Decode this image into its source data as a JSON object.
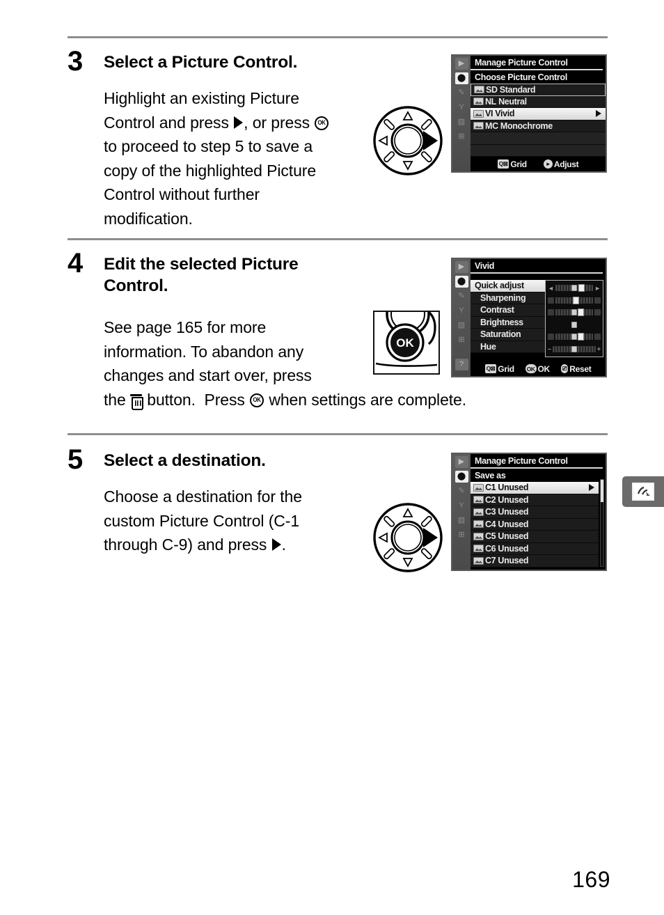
{
  "page": {
    "number": "169",
    "side_tab_icon": "retouch-menu-icon"
  },
  "steps": [
    {
      "number": "3",
      "heading": "Select a Picture Control.",
      "body_lines": [
        "Highlight an existing Picture",
        "Control and press ▶, or press ⒪",
        "to proceed to step 5 to save a",
        "copy of the highlighted Picture",
        "Control without further",
        "modification."
      ],
      "illustration": "multi-selector-right"
    },
    {
      "number": "4",
      "heading_lines": [
        "Edit the selected Picture",
        "Control."
      ],
      "body_lines": [
        "See page 165 for more",
        "information.   To abandon any",
        "changes and start over, press",
        "the ♻ button.  Press ⒪ when settings are complete."
      ],
      "illustration": "ok-button"
    },
    {
      "number": "5",
      "heading": "Select a destination.",
      "body_lines": [
        "Choose a destination for the",
        "custom Picture Control (C-1",
        "through C-9) and press ▶."
      ],
      "illustration": "multi-selector-right"
    }
  ],
  "lcd_screens": [
    {
      "id": "manage-picture-control-choose",
      "title": "Manage Picture Control",
      "subtitle": "Choose Picture Control",
      "rows": [
        {
          "badge": "SD",
          "label": "Standard",
          "state": "boxed",
          "arrow": false
        },
        {
          "badge": "NL",
          "label": "Neutral",
          "state": "normal",
          "arrow": false
        },
        {
          "badge": "VI",
          "label": "Vivid",
          "state": "selected",
          "arrow": true
        },
        {
          "badge": "MC",
          "label": "Monochrome",
          "state": "normal",
          "arrow": false
        }
      ],
      "bottom_hints": [
        {
          "key": "Q",
          "label": "Grid"
        },
        {
          "key": "▶",
          "label": "Adjust"
        }
      ],
      "sidebar_icons": [
        "playback-icon",
        "shooting-menu-icon",
        "custom-settings-icon",
        "setup-menu-icon",
        "retouch-menu-icon",
        "recent-settings-icon"
      ],
      "sidebar_active_index": 1
    },
    {
      "id": "vivid-edit",
      "title": "Vivid",
      "subtitle": "",
      "rows": [
        {
          "label": "Quick adjust",
          "state": "selected",
          "slider": {
            "value": 0,
            "knob": 62
          }
        },
        {
          "label": "Sharpening",
          "state": "normal",
          "slider": {
            "value": 0,
            "knob": 50
          }
        },
        {
          "label": "Contrast",
          "state": "normal",
          "slider": {
            "value": 0,
            "knob": 62
          }
        },
        {
          "label": "Brightness",
          "state": "normal",
          "slider": {
            "value": 0,
            "knob": 50
          }
        },
        {
          "label": "Saturation",
          "state": "normal",
          "slider": {
            "value": 0,
            "knob": 62
          }
        },
        {
          "label": "Hue",
          "state": "normal",
          "slider": {
            "value": 0,
            "knob": 50
          }
        }
      ],
      "bottom_hints": [
        {
          "key": "Q",
          "label": "Grid"
        },
        {
          "key": "OK",
          "label": "OK"
        },
        {
          "key": "♻",
          "label": "Reset"
        }
      ],
      "sidebar_icons": [
        "playback-icon",
        "shooting-menu-icon",
        "custom-settings-icon",
        "setup-menu-icon",
        "retouch-menu-icon",
        "recent-settings-icon",
        "help-icon"
      ],
      "sidebar_active_index": 1
    },
    {
      "id": "manage-picture-control-save-as",
      "title": "Manage Picture Control",
      "subtitle": "Save as",
      "rows": [
        {
          "badge": "C1",
          "label": "Unused",
          "state": "selected",
          "arrow": true
        },
        {
          "badge": "C2",
          "label": "Unused",
          "state": "normal",
          "arrow": false
        },
        {
          "badge": "C3",
          "label": "Unused",
          "state": "normal",
          "arrow": false
        },
        {
          "badge": "C4",
          "label": "Unused",
          "state": "normal",
          "arrow": false
        },
        {
          "badge": "C5",
          "label": "Unused",
          "state": "normal",
          "arrow": false
        },
        {
          "badge": "C6",
          "label": "Unused",
          "state": "normal",
          "arrow": false
        },
        {
          "badge": "C7",
          "label": "Unused",
          "state": "normal",
          "arrow": false
        }
      ],
      "bottom_hints": [],
      "sidebar_icons": [
        "playback-icon",
        "shooting-menu-icon",
        "custom-settings-icon",
        "setup-menu-icon",
        "retouch-menu-icon",
        "recent-settings-icon"
      ],
      "sidebar_active_index": 1,
      "scrollbar": true
    }
  ],
  "ok_button": {
    "label": "OK"
  },
  "colors": {
    "rule": "#8e8e8e",
    "lcd_background": "#000000",
    "lcd_selected": "#e8e8e8",
    "side_tab": "#6b6b6b"
  }
}
